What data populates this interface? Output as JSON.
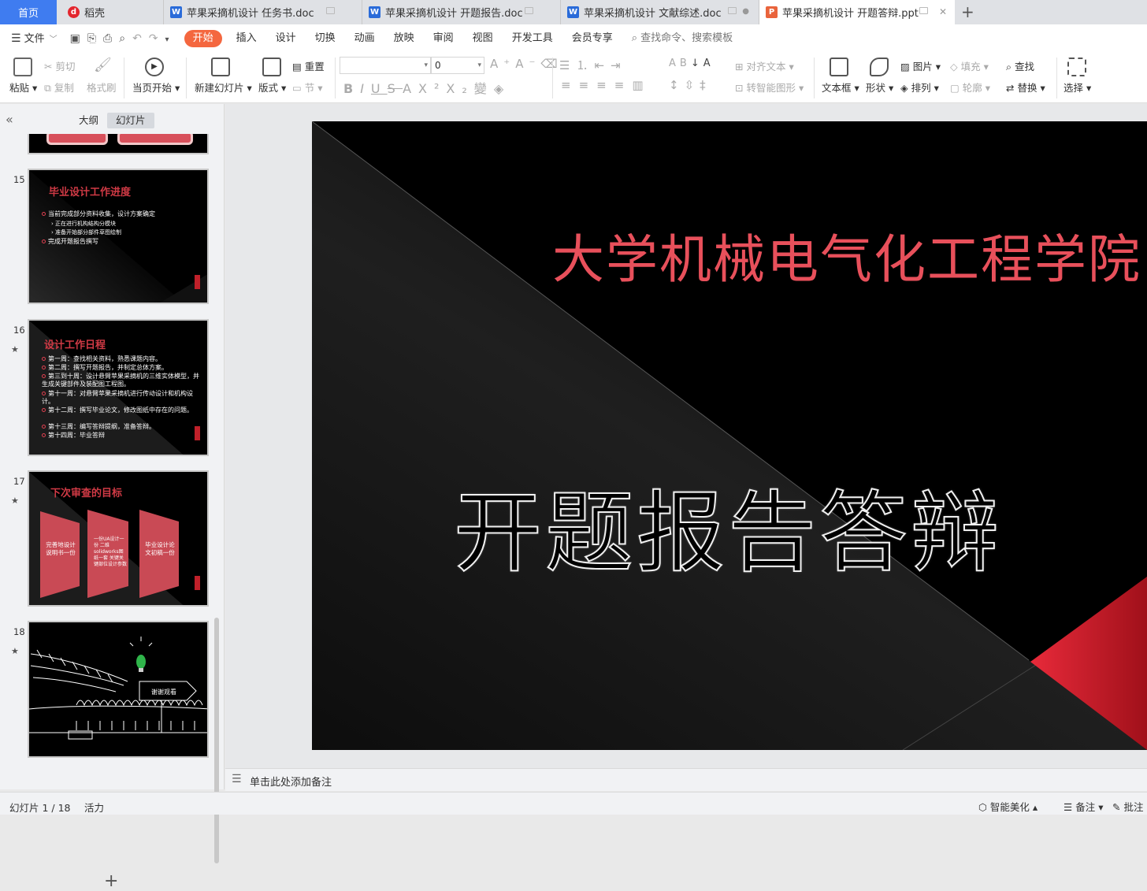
{
  "tabs": {
    "home": "首页",
    "daoke": "稻壳",
    "doc1": "苹果采摘机设计 任务书.doc",
    "doc2": "苹果采摘机设计 开题报告.doc",
    "doc3": "苹果采摘机设计 文献综述.doc",
    "ppt": "苹果采摘机设计 开题答辩.ppt"
  },
  "menu": {
    "file": "文件",
    "items": [
      "开始",
      "插入",
      "设计",
      "切换",
      "动画",
      "放映",
      "审阅",
      "视图",
      "开发工具",
      "会员专享"
    ],
    "search": "查找命令、搜索模板"
  },
  "ribbon": {
    "paste": "粘贴",
    "cut": "剪切",
    "copy": "复制",
    "format_painter": "格式刷",
    "from_current": "当页开始",
    "new_slide": "新建幻灯片",
    "layout": "版式",
    "reset": "重置",
    "section": "节",
    "font_size": "0",
    "align_text": "对齐文本",
    "smart_shape": "转智能图形",
    "textbox": "文本框",
    "shape": "形状",
    "picture": "图片",
    "arrange": "排列",
    "fill": "填充",
    "outline": "轮廓",
    "find": "查找",
    "replace": "替换",
    "select": "选择"
  },
  "panel": {
    "outline_tab": "大纲",
    "slides_tab": "幻灯片"
  },
  "slides": [
    {
      "num": "15",
      "title": "毕业设计工作进度",
      "bullets": [
        "当前完成部分资料收集，设计方案确定",
        "正在进行机构结构分模块",
        "准备开始部分部件草图绘制",
        "完成开题报告撰写"
      ]
    },
    {
      "num": "16",
      "title": "设计工作日程",
      "bullets": [
        "第一周：查找相关资料，熟悉课题内容。",
        "第二周：撰写开题报告，并制定总体方案。",
        "第三到十周：设计悬臂苹果采摘机的三维实体模型，并生成关键部件及装配图工程图。",
        "第十一周：对悬臂苹果采摘机进行传动设计和机构设计。",
        "第十二周：撰写毕业论文，修改图纸中存在的问题。",
        "第十三周：编写答辩提纲，准备答辩。",
        "第十四周：毕业答辩"
      ]
    },
    {
      "num": "17",
      "title": "下次审查的目标",
      "boxes": [
        "完善地设计说明书一份",
        "一份UA设计一份 二维solidworks图纸一套 关键关键部位设计参数",
        "毕业设计论文初稿一份"
      ]
    },
    {
      "num": "18",
      "sign": "谢谢观看"
    }
  ],
  "main_slide": {
    "college": "大学机械电气化工程学院",
    "title": "开题报告答辩"
  },
  "notes_placeholder": "单击此处添加备注",
  "status": {
    "slide_counter": "幻灯片 1 / 18",
    "theme": "活力",
    "beautify": "智能美化",
    "notes": "备注",
    "comments": "批注"
  },
  "colors": {
    "accent": "#f4673f",
    "home_tab": "#3f7cf0",
    "slide_red": "#e8505b"
  }
}
